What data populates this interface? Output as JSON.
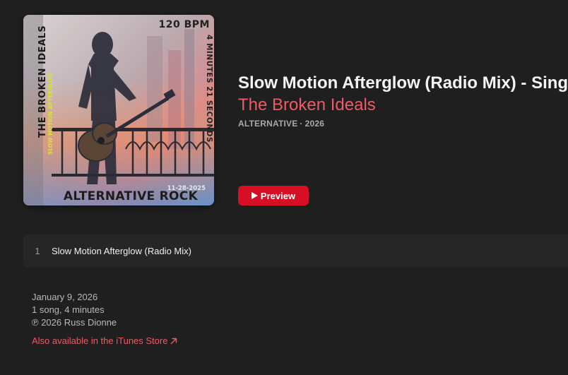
{
  "artwork": {
    "bpm": "120 BPM",
    "band": "THE BROKEN IDEALS",
    "song": "SLOW MOTION AFTERGLOW",
    "duration": "4 MINUTES 21 SECONDS",
    "date": "11-28-2025",
    "genre": "ALTERNATIVE ROCK"
  },
  "header": {
    "title": "Slow Motion Afterglow (Radio Mix) - Single",
    "artist": "The Broken Ideals",
    "genre": "ALTERNATIVE",
    "separator": "·",
    "year": "2026"
  },
  "preview_button": {
    "label": "Preview",
    "icon": "play-icon"
  },
  "tracks": [
    {
      "number": "1",
      "title": "Slow Motion Afterglow (Radio Mix)"
    }
  ],
  "footer": {
    "release_date": "January 9, 2026",
    "summary": "1 song, 4 minutes",
    "copyright": "℗ 2026 Russ Dionne",
    "store_link": "Also available in the iTunes Store",
    "store_icon": "external-arrow-icon"
  },
  "colors": {
    "background": "#1f1f1f",
    "accent": "#ef5a67",
    "button": "#d60f25"
  }
}
